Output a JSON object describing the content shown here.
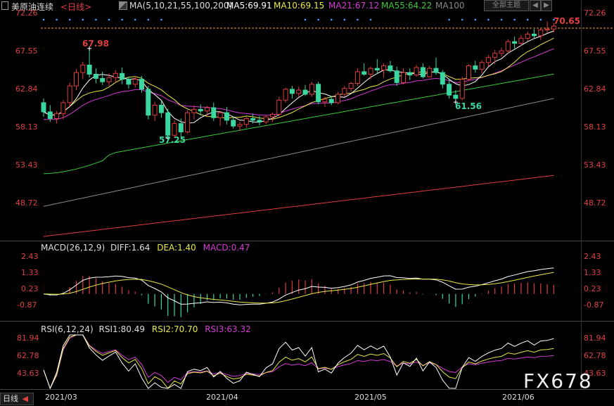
{
  "main_header": {
    "instrument": "美原油连续",
    "period": "日线",
    "ma_label": "MA(5,10,21,55,100,200)",
    "ma_items": [
      {
        "text": "MA5:69.91",
        "color": "#ffffff"
      },
      {
        "text": "MA10:69.15",
        "color": "#e8e84a"
      },
      {
        "text": "MA21:67.12",
        "color": "#d23cd2"
      },
      {
        "text": "MA55:64.22",
        "color": "#3cc83c"
      },
      {
        "text": "MA100",
        "color": "#888888"
      }
    ]
  },
  "toolbar": {
    "theme_button": "全部主题",
    "arrows": [
      "◀",
      "▶"
    ]
  },
  "main_axis": {
    "ticks": [
      "72.26",
      "67.55",
      "62.84",
      "58.13",
      "53.43",
      "48.72"
    ]
  },
  "annotations": {
    "high": "67.98",
    "low_left": "57.25",
    "low_right": "61.56",
    "last_price": "70.65"
  },
  "macd_header": {
    "label": "MACD(26,12,9)",
    "diff": "DIFF:1.64",
    "dea": "DEA:1.40",
    "macd": "MACD:0.47"
  },
  "macd_axis": {
    "ticks": [
      "2.43",
      "1.33",
      "0.23",
      "-0.87"
    ]
  },
  "rsi_header": {
    "label": "RSI(6,12,24)",
    "rsi1": "RSI1:80.49",
    "rsi2": "RSI2:70.70",
    "rsi3": "RSI3:63.32"
  },
  "rsi_axis": {
    "ticks": [
      "81.94",
      "62.78",
      "43.63"
    ]
  },
  "x_axis": {
    "period_button": "日线",
    "dates": [
      "2021/03",
      "2021/04",
      "2021/05",
      "2021/06"
    ]
  },
  "watermark": "FX678",
  "colors": {
    "up": "#e03c3c",
    "down": "#3ad7a0",
    "ma5": "#ffffff",
    "ma10": "#e8e84a",
    "ma21": "#d23cd2",
    "ma55": "#3cc83c",
    "ma100": "#888888",
    "ma200": "#e03c3c"
  },
  "chart_data": {
    "type": "candlestick",
    "ohlc": [
      [
        61.5,
        62.0,
        59.8,
        60.4
      ],
      [
        60.4,
        61.2,
        59.2,
        59.6
      ],
      [
        59.6,
        60.5,
        59.0,
        60.2
      ],
      [
        60.2,
        61.8,
        59.5,
        61.5
      ],
      [
        61.5,
        63.9,
        61.0,
        63.5
      ],
      [
        63.5,
        65.5,
        63.0,
        65.1
      ],
      [
        65.1,
        66.4,
        64.3,
        66.0
      ],
      [
        66.0,
        67.98,
        64.5,
        64.9
      ],
      [
        64.9,
        65.6,
        63.8,
        64.4
      ],
      [
        64.4,
        65.2,
        63.6,
        64.0
      ],
      [
        64.0,
        65.0,
        63.5,
        64.5
      ],
      [
        64.5,
        65.4,
        63.9,
        65.0
      ],
      [
        65.0,
        65.7,
        63.7,
        64.3
      ],
      [
        64.3,
        64.6,
        63.2,
        63.7
      ],
      [
        63.7,
        64.7,
        63.3,
        64.3
      ],
      [
        64.3,
        64.7,
        62.7,
        63.1
      ],
      [
        63.1,
        63.5,
        59.5,
        60.0
      ],
      [
        60.0,
        61.6,
        59.3,
        61.2
      ],
      [
        61.2,
        61.7,
        59.7,
        60.3
      ],
      [
        60.3,
        60.8,
        57.25,
        57.6
      ],
      [
        57.6,
        59.4,
        57.3,
        59.0
      ],
      [
        59.0,
        59.6,
        57.4,
        58.0
      ],
      [
        58.0,
        60.6,
        57.8,
        60.3
      ],
      [
        60.3,
        61.2,
        59.5,
        60.7
      ],
      [
        60.7,
        61.3,
        60.0,
        60.5
      ],
      [
        60.5,
        61.1,
        59.8,
        60.9
      ],
      [
        60.9,
        61.5,
        59.3,
        59.7
      ],
      [
        59.7,
        60.5,
        58.7,
        60.3
      ],
      [
        60.3,
        61.0,
        58.9,
        59.4
      ],
      [
        59.4,
        59.8,
        58.4,
        58.7
      ],
      [
        58.7,
        59.2,
        58.1,
        58.9
      ],
      [
        58.9,
        59.8,
        58.5,
        59.6
      ],
      [
        59.6,
        60.2,
        59.0,
        59.4
      ],
      [
        59.4,
        59.9,
        58.8,
        59.2
      ],
      [
        59.2,
        60.0,
        58.9,
        59.8
      ],
      [
        59.8,
        60.3,
        59.2,
        60.1
      ],
      [
        60.1,
        62.2,
        59.9,
        61.8
      ],
      [
        61.8,
        63.3,
        61.5,
        63.1
      ],
      [
        63.1,
        63.5,
        62.0,
        62.6
      ],
      [
        62.6,
        63.4,
        62.2,
        63.0
      ],
      [
        63.0,
        63.6,
        62.3,
        62.5
      ],
      [
        62.5,
        64.0,
        62.2,
        63.7
      ],
      [
        63.7,
        64.0,
        61.3,
        61.6
      ],
      [
        61.6,
        62.2,
        61.0,
        61.9
      ],
      [
        61.9,
        62.3,
        61.2,
        61.5
      ],
      [
        61.5,
        62.8,
        61.3,
        62.5
      ],
      [
        62.5,
        63.5,
        62.2,
        63.2
      ],
      [
        63.2,
        64.0,
        62.8,
        63.8
      ],
      [
        63.8,
        65.6,
        63.5,
        65.2
      ],
      [
        65.2,
        66.2,
        64.7,
        64.9
      ],
      [
        64.9,
        65.8,
        64.3,
        65.6
      ],
      [
        65.6,
        66.7,
        65.0,
        65.4
      ],
      [
        65.4,
        66.2,
        64.5,
        65.9
      ],
      [
        65.9,
        66.5,
        65.1,
        65.3
      ],
      [
        65.3,
        65.8,
        63.5,
        63.9
      ],
      [
        63.9,
        65.6,
        63.7,
        65.1
      ],
      [
        65.1,
        65.6,
        64.2,
        64.8
      ],
      [
        64.8,
        66.0,
        64.6,
        65.7
      ],
      [
        65.7,
        66.2,
        64.4,
        64.6
      ],
      [
        64.6,
        65.9,
        64.5,
        65.6
      ],
      [
        65.6,
        66.9,
        64.8,
        65.1
      ],
      [
        65.1,
        65.4,
        63.2,
        63.7
      ],
      [
        63.7,
        64.3,
        62.0,
        62.4
      ],
      [
        62.4,
        63.0,
        61.56,
        62.0
      ],
      [
        62.0,
        64.6,
        61.8,
        64.3
      ],
      [
        64.3,
        66.1,
        64.1,
        65.9
      ],
      [
        65.9,
        66.5,
        65.1,
        65.5
      ],
      [
        65.5,
        66.6,
        65.0,
        66.3
      ],
      [
        66.3,
        67.2,
        65.8,
        66.9
      ],
      [
        66.9,
        67.8,
        66.1,
        67.4
      ],
      [
        67.4,
        68.1,
        67.0,
        67.7
      ],
      [
        67.7,
        69.1,
        67.4,
        68.8
      ],
      [
        68.8,
        69.4,
        68.0,
        68.6
      ],
      [
        68.6,
        69.6,
        68.3,
        69.2
      ],
      [
        69.2,
        70.0,
        68.9,
        69.7
      ],
      [
        69.7,
        70.3,
        69.2,
        69.5
      ],
      [
        69.5,
        70.4,
        69.0,
        70.2
      ],
      [
        70.2,
        71.2,
        69.8,
        70.3
      ],
      [
        70.3,
        71.0,
        69.9,
        70.65
      ]
    ],
    "ylim": [
      45.0,
      72.26
    ],
    "ma100_range": [
      49.1,
      62.0
    ],
    "ma200_range": [
      45.5,
      52.8
    ]
  }
}
